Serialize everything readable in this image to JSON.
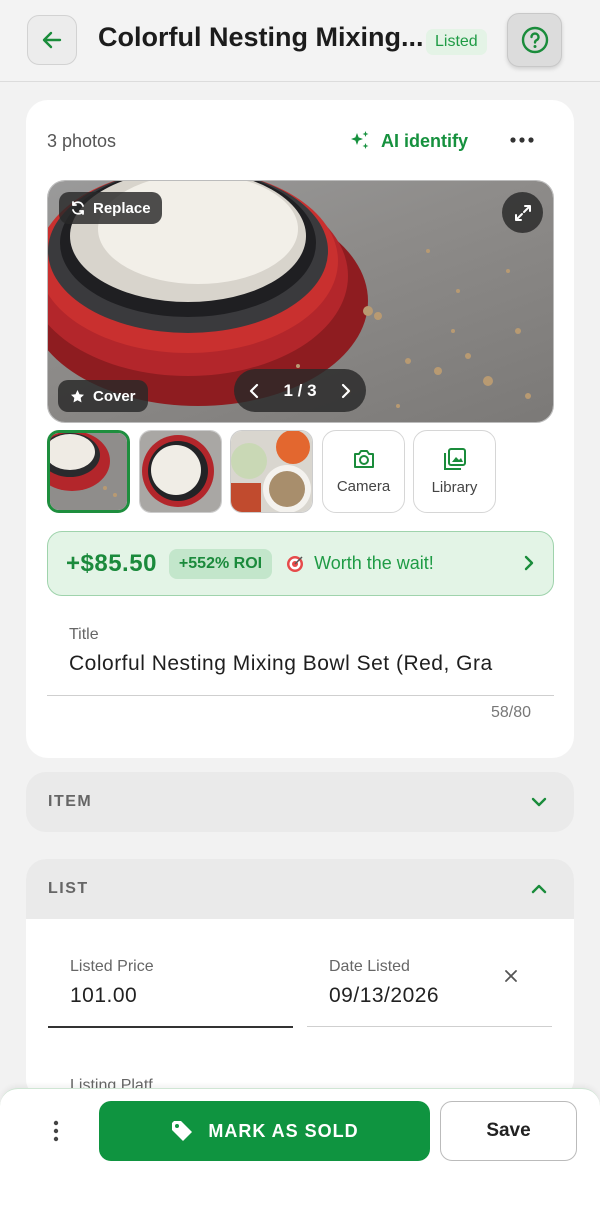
{
  "header": {
    "title": "Colorful Nesting Mixing...",
    "status": "Listed"
  },
  "photos": {
    "count_label": "3 photos",
    "ai_identify_label": "AI identify",
    "replace_label": "Replace",
    "cover_label": "Cover",
    "pager_label": "1 / 3",
    "camera_label": "Camera",
    "library_label": "Library"
  },
  "profit": {
    "amount": "+$85.50",
    "roi": "+552% ROI",
    "message": "Worth the wait!"
  },
  "title_field": {
    "label": "Title",
    "value": "Colorful Nesting Mixing Bowl Set (Red, Gra",
    "char_count": "58/80"
  },
  "sections": {
    "item_label": "ITEM",
    "list_label": "LIST"
  },
  "list": {
    "price_label": "Listed Price",
    "price_value": "101.00",
    "date_label": "Date Listed",
    "date_value": "09/13/2026",
    "platform_label": "Listing Platf"
  },
  "actions": {
    "mark_sold_label": "MARK AS SOLD",
    "save_label": "Save"
  },
  "colors": {
    "brand_green": "#0f9440",
    "accent_green": "#1f9b45",
    "banner_bg": "#e3f4e6"
  }
}
